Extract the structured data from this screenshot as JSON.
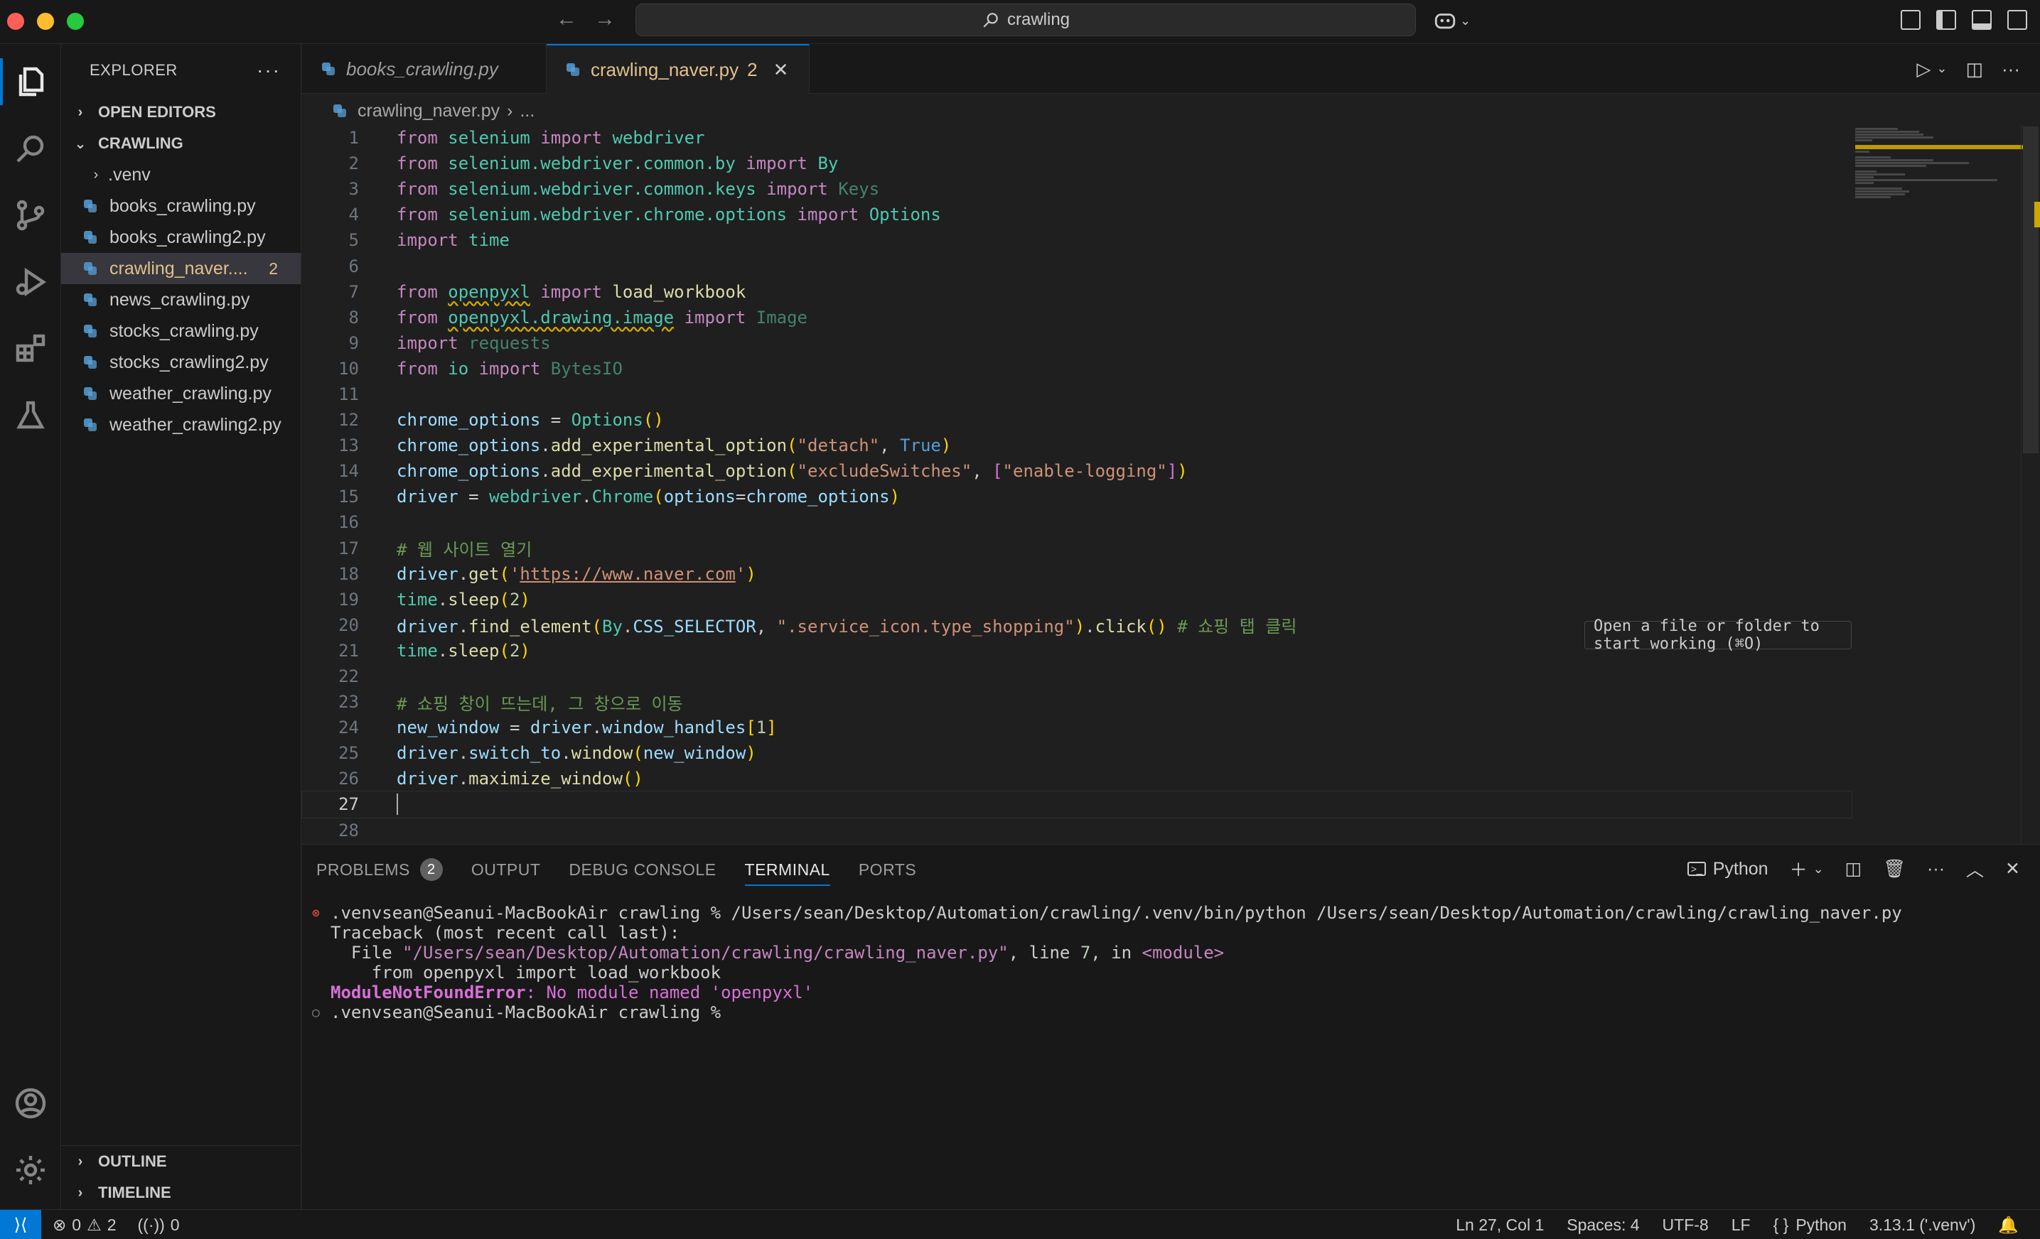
{
  "titlebar": {
    "search_text": "crawling"
  },
  "sidebar": {
    "title": "EXPLORER",
    "open_editors": "OPEN EDITORS",
    "folder": "CRAWLING",
    "items": [
      {
        "name": ".venv",
        "type": "folder"
      },
      {
        "name": "books_crawling.py",
        "type": "file"
      },
      {
        "name": "books_crawling2.py",
        "type": "file"
      },
      {
        "name": "crawling_naver....",
        "type": "file",
        "badge": "2",
        "selected": true
      },
      {
        "name": "news_crawling.py",
        "type": "file"
      },
      {
        "name": "stocks_crawling.py",
        "type": "file"
      },
      {
        "name": "stocks_crawling2.py",
        "type": "file"
      },
      {
        "name": "weather_crawling.py",
        "type": "file"
      },
      {
        "name": "weather_crawling2.py",
        "type": "file"
      }
    ],
    "outline": "OUTLINE",
    "timeline": "TIMELINE"
  },
  "tabs": [
    {
      "label": "books_crawling.py"
    },
    {
      "label": "crawling_naver.py",
      "count": "2"
    }
  ],
  "breadcrumbs": {
    "file": "crawling_naver.py",
    "rest": "..."
  },
  "editor": {
    "lines": [
      "from selenium import webdriver",
      "from selenium.webdriver.common.by import By",
      "from selenium.webdriver.common.keys import Keys",
      "from selenium.webdriver.chrome.options import Options",
      "import time",
      "",
      "from openpyxl import load_workbook",
      "from openpyxl.drawing.image import Image",
      "import requests",
      "from io import BytesIO",
      "",
      "chrome_options = Options()",
      "chrome_options.add_experimental_option(\"detach\", True)",
      "chrome_options.add_experimental_option(\"excludeSwitches\", [\"enable-logging\"])",
      "driver = webdriver.Chrome(options=chrome_options)",
      "",
      "# 웹 사이트 열기",
      "driver.get('https://www.naver.com')",
      "time.sleep(2)",
      "driver.find_element(By.CSS_SELECTOR, \".service_icon.type_shopping\").click() # 쇼핑 탭 클릭",
      "time.sleep(2)",
      "",
      "# 쇼핑 창이 뜨는데, 그 창으로 이동",
      "new_window = driver.window_handles[1]",
      "driver.switch_to.window(new_window)",
      "driver.maximize_window()",
      "",
      ""
    ],
    "current_line": 27,
    "tooltip": "Open a file or folder to start working (⌘O)"
  },
  "panel": {
    "tabs": [
      "PROBLEMS",
      "OUTPUT",
      "DEBUG CONSOLE",
      "TERMINAL",
      "PORTS"
    ],
    "problems_count": "2",
    "active_tab": "TERMINAL",
    "shell_label": "Python",
    "terminal": {
      "cmd_line": ".venvsean@Seanui-MacBookAir crawling % /Users/sean/Desktop/Automation/crawling/.venv/bin/python /Users/sean/Desktop/Automation/crawling/crawling_naver.py",
      "traceback": "Traceback (most recent call last):",
      "file_prefix": "  File ",
      "file_path": "\"/Users/sean/Desktop/Automation/crawling/crawling_naver.py\"",
      "line_sep": ", line ",
      "line_num": "7",
      "in_sep": ", in ",
      "module": "<module>",
      "source": "    from openpyxl import load_workbook",
      "error_name": "ModuleNotFoundError",
      "error_msg": ": No module named 'openpyxl'",
      "prompt": ".venvsean@Seanui-MacBookAir crawling % "
    }
  },
  "statusbar": {
    "errors": "0",
    "warnings": "2",
    "ports": "0",
    "position": "Ln 27, Col 1",
    "spaces": "Spaces: 4",
    "encoding": "UTF-8",
    "eol": "LF",
    "language": "Python",
    "interpreter": "3.13.1 ('.venv')"
  },
  "colors": {
    "accent": "#0078d4",
    "modified": "#e2c08d",
    "error": "#f14c4c"
  }
}
